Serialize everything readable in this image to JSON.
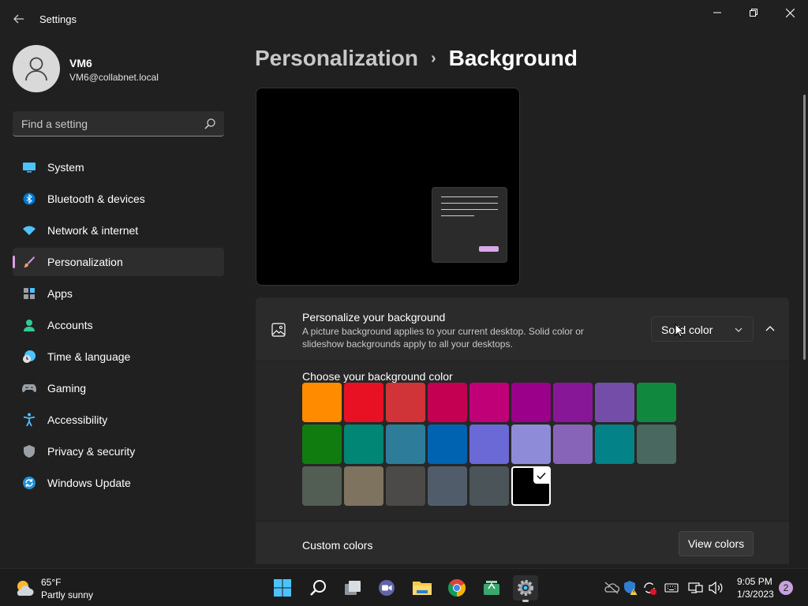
{
  "window": {
    "title": "Settings"
  },
  "user": {
    "name": "VM6",
    "email": "VM6@collabnet.local"
  },
  "search": {
    "placeholder": "Find a setting"
  },
  "nav": {
    "items": [
      {
        "label": "System",
        "icon": "monitor-icon"
      },
      {
        "label": "Bluetooth & devices",
        "icon": "bluetooth-icon"
      },
      {
        "label": "Network & internet",
        "icon": "wifi-icon"
      },
      {
        "label": "Personalization",
        "icon": "brush-icon",
        "active": true
      },
      {
        "label": "Apps",
        "icon": "apps-icon"
      },
      {
        "label": "Accounts",
        "icon": "person-icon"
      },
      {
        "label": "Time & language",
        "icon": "clock-globe-icon"
      },
      {
        "label": "Gaming",
        "icon": "gamepad-icon"
      },
      {
        "label": "Accessibility",
        "icon": "accessibility-icon"
      },
      {
        "label": "Privacy & security",
        "icon": "shield-icon"
      },
      {
        "label": "Windows Update",
        "icon": "update-icon"
      }
    ]
  },
  "breadcrumb": {
    "parent": "Personalization",
    "separator": "›",
    "current": "Background"
  },
  "background": {
    "title": "Personalize your background",
    "description": "A picture background applies to your current desktop. Solid color or slideshow backgrounds apply to all your desktops.",
    "dropdown_value": "Solid color",
    "color_label": "Choose your background color",
    "colors": [
      "#ff8c00",
      "#e81123",
      "#d13438",
      "#c30052",
      "#bf0077",
      "#9a0089",
      "#881798",
      "#744da9",
      "#10893e",
      "#107c10",
      "#018574",
      "#2d7d9a",
      "#0063b1",
      "#6b69d6",
      "#8e8cd8",
      "#8764b8",
      "#038387",
      "#486860",
      "#525e54",
      "#7e735f",
      "#4c4a48",
      "#515c6b",
      "#4a5459",
      "#000000"
    ],
    "selected_color": "#000000",
    "custom_label": "Custom colors",
    "view_colors_label": "View colors"
  },
  "taskbar": {
    "weather_temp": "65°F",
    "weather_desc": "Partly sunny",
    "time": "9:05 PM",
    "date": "1/3/2023",
    "notification_count": "2"
  },
  "accent": "#d6a0e6"
}
